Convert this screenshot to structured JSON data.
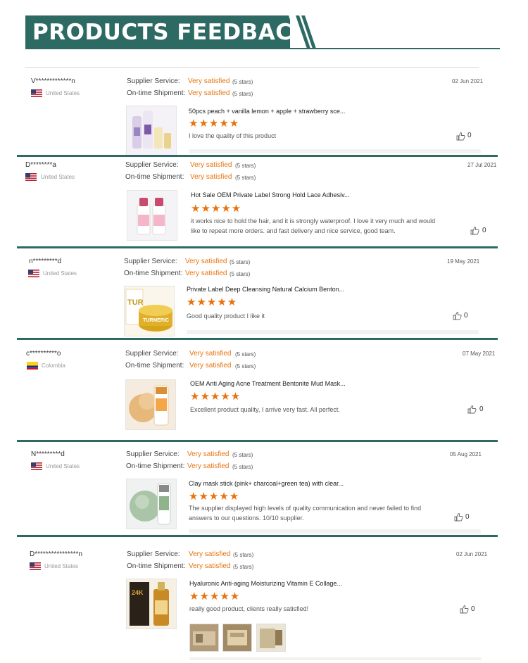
{
  "banner": {
    "title": "PRODUCTS FEEDBACK"
  },
  "colors": {
    "accent": "#2e6a64",
    "rating": "#e8730e"
  },
  "labels": {
    "supplier_service": "Supplier Service:",
    "shipment": "On-time Shipment:"
  },
  "reviews": [
    {
      "reviewer": "V*************n",
      "country": "United States",
      "flag": "us-flag-icon",
      "supplier_rating": "Very satisfied",
      "supplier_stars": "(5 stars)",
      "shipment_rating": "Very satisfied",
      "shipment_stars": "(5 stars)",
      "date": "02 Jun 2021",
      "product": "50pcs peach + vanilla lemon + apple + strawberry sce...",
      "rating": "★★★★★",
      "comment": "I love the quality of this product",
      "likes": "0"
    },
    {
      "reviewer": "D********a",
      "country": "United States",
      "flag": "us-flag-icon",
      "supplier_rating": "Very satisfied",
      "supplier_stars": "(5 stars)",
      "shipment_rating": "Very satisfied",
      "shipment_stars": "(5 stars)",
      "date": "27 Jul 2021",
      "product": "Hot Sale OEM Private Label Strong Hold Lace Adhesiv...",
      "rating": "★★★★★",
      "comment": "it works nice to hold the hair, and it is strongly waterproof. I love it very much and would like to repeat more orders. and fast delivery and nice service, good team.",
      "likes": "0"
    },
    {
      "reviewer": "n*********d",
      "country": "United States",
      "flag": "us-flag-icon",
      "supplier_rating": "Very satisfied",
      "supplier_stars": "(5 stars)",
      "shipment_rating": "Very satisfied",
      "shipment_stars": "(5 stars)",
      "date": "19 May 2021",
      "product": "Private Label Deep Cleansing Natural Calcium Benton...",
      "rating": "★★★★★",
      "comment": "Good quality product I like it",
      "likes": "0"
    },
    {
      "reviewer": "c**********o",
      "country": "Colombia",
      "flag": "colombia-flag-icon",
      "supplier_rating": "Very satisfied",
      "supplier_stars": "(5 stars)",
      "shipment_rating": "Very satisfied",
      "shipment_stars": "(5 stars)",
      "date": "07 May 2021",
      "product": "OEM Anti Aging Acne Treatment Bentonite Mud Mask...",
      "rating": "★★★★★",
      "comment": "Excellent product quality, I arrive very fast. All perfect.",
      "likes": "0"
    },
    {
      "reviewer": "N*********d",
      "country": "United States",
      "flag": "us-flag-icon",
      "supplier_rating": "Very satisfied",
      "supplier_stars": "(5 stars)",
      "shipment_rating": "Very satisfied",
      "shipment_stars": "(5 stars)",
      "date": "05 Aug 2021",
      "product": "Clay mask stick (pink+ charcoal+green tea) with clear...",
      "rating": "★★★★★",
      "comment": "The supplier displayed high levels of quality communication and never failed to find answers to our questions. 10/10 supplier.",
      "likes": "0"
    },
    {
      "reviewer": "D****************n",
      "country": "United States",
      "flag": "us-flag-icon",
      "supplier_rating": "Very satisfied",
      "supplier_stars": "(5 stars)",
      "shipment_rating": "Very satisfied",
      "shipment_stars": "(5 stars)",
      "date": "02 Jun 2021",
      "product": "Hyaluronic Anti-aging Moisturizing Vitamin E Collage...",
      "rating": "★★★★★",
      "comment": "really good product, clients really satisfied!",
      "likes": "0"
    }
  ]
}
